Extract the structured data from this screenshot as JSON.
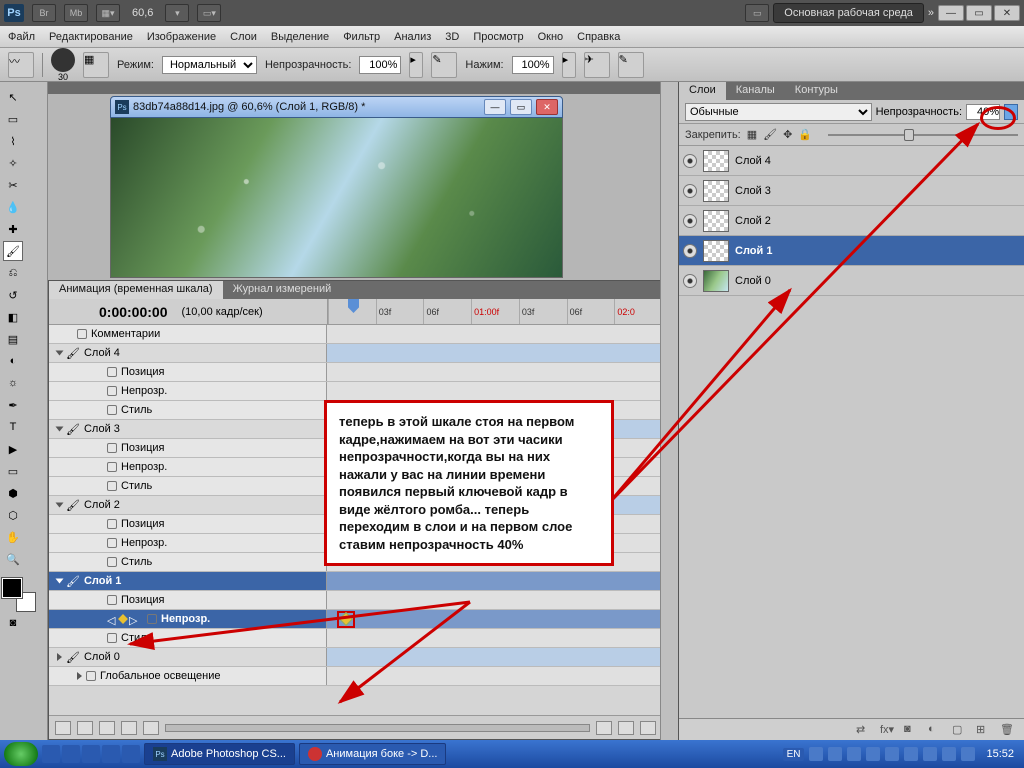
{
  "appbar": {
    "logo": "Ps",
    "br": "Br",
    "mb": "Mb",
    "zoom": "60,6",
    "workspace": "Основная рабочая среда"
  },
  "menu": [
    "Файл",
    "Редактирование",
    "Изображение",
    "Слои",
    "Выделение",
    "Фильтр",
    "Анализ",
    "3D",
    "Просмотр",
    "Окно",
    "Справка"
  ],
  "opt": {
    "size": "30",
    "mode_label": "Режим:",
    "mode": "Нормальный",
    "opacity_label": "Непрозрачность:",
    "opacity": "100%",
    "flow_label": "Нажим:",
    "flow": "100%"
  },
  "doc": {
    "title": "83db74a88d14.jpg @ 60,6% (Слой 1, RGB/8) *"
  },
  "anim": {
    "tab1": "Анимация (временная шкала)",
    "tab2": "Журнал измерений",
    "timecode": "0:00:00:00",
    "fps": "(10,00 кадр/сек)",
    "ticks": [
      "",
      "03f",
      "06f",
      "01:00f",
      "03f",
      "06f",
      "02:0"
    ],
    "rows": {
      "comments": "Комментарии",
      "l4": "Слой 4",
      "l3": "Слой 3",
      "l2": "Слой 2",
      "l1": "Слой 1",
      "l0": "Слой 0",
      "pos": "Позиция",
      "opac": "Непрозр.",
      "style": "Стиль",
      "global": "Глобальное освещение"
    }
  },
  "layers": {
    "tab1": "Слои",
    "tab2": "Каналы",
    "tab3": "Контуры",
    "blend": "Обычные",
    "opacity_label": "Непрозрачность:",
    "opacity": "40%",
    "lock_label": "Закрепить:",
    "items": [
      "Слой 4",
      "Слой 3",
      "Слой 2",
      "Слой 1",
      "Слой 0"
    ]
  },
  "annot": "теперь в этой шкале стоя на первом кадре,нажимаем на вот эти часики непрозрачности,когда вы на них нажали у вас на линии времени появился первый ключевой кадр в виде жёлтого ромба... теперь переходим в слои и на первом слое ставим непрозрачность  40%",
  "taskbar": {
    "t1": "Adobe Photoshop CS...",
    "t2": "Анимация боке -> D...",
    "lang": "EN",
    "clock": "15:52"
  }
}
